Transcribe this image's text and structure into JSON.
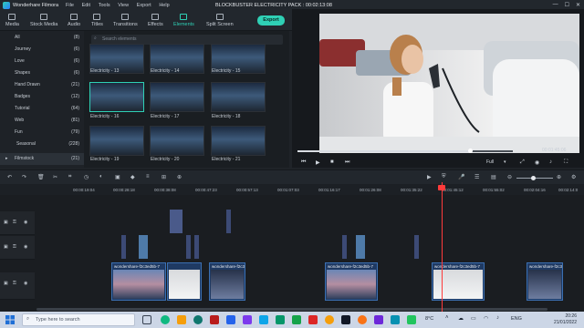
{
  "app": {
    "title": "Wonderhare Filmora",
    "project": "BLOCKBUSTER ELECTRICITY PACK : 00:02:13:08"
  },
  "menu": [
    "File",
    "Edit",
    "Tools",
    "View",
    "Export",
    "Help"
  ],
  "tabs": [
    {
      "label": "Media"
    },
    {
      "label": "Stock Media"
    },
    {
      "label": "Audio"
    },
    {
      "label": "Titles"
    },
    {
      "label": "Transitions"
    },
    {
      "label": "Effects"
    },
    {
      "label": "Elements",
      "active": true
    },
    {
      "label": "Split Screen"
    }
  ],
  "export_label": "Export",
  "sidebar": {
    "items": [
      {
        "label": "All",
        "count": "(8)"
      },
      {
        "label": "Journey",
        "count": "(6)"
      },
      {
        "label": "Love",
        "count": "(6)"
      },
      {
        "label": "Shapes",
        "count": "(6)"
      },
      {
        "label": "Hand Drawn",
        "count": "(21)"
      },
      {
        "label": "Badges",
        "count": "(12)"
      },
      {
        "label": "Tutorial",
        "count": "(64)"
      },
      {
        "label": "Web",
        "count": "(81)"
      },
      {
        "label": "Fun",
        "count": "(79)"
      },
      {
        "label": "Seasonal",
        "count": "(228)"
      },
      {
        "label": "Filmstock",
        "count": "(21)",
        "selected": true
      }
    ]
  },
  "search": {
    "placeholder": "Search elements"
  },
  "elements": [
    "Electricity - 13",
    "Electricity - 14",
    "Electricity - 15",
    "Electricity - 16",
    "Electricity - 17",
    "Electricity - 18",
    "Electricity - 19",
    "Electricity - 20",
    "Electricity - 21"
  ],
  "player": {
    "timecode": "00:01:45:06",
    "quality": "Full",
    "progress": 0.8
  },
  "ruler": {
    "ticks": [
      "00:00:19:04",
      "00:00:28:18",
      "00:00:38:08",
      "00:00:47:23",
      "00:00:57:13",
      "00:01:07:03",
      "00:01:16:17",
      "00:01:26:08",
      "00:01:35:22",
      "00:01:45:12",
      "00:01:55:02",
      "00:02:04:16",
      "00:02:14:0"
    ]
  },
  "clips": [
    "wondershare-f2c3ed5b-7",
    "wondershare-f2c3ed5b-7",
    "wondershare-f2c3ed5b-7",
    "wondershare-f2c3ed5b-7",
    "wondershare-f2c3ed5b-7",
    "wondershare-f2c3ed5b-7"
  ],
  "taskbar": {
    "search_placeholder": "Type here to search",
    "temp": "8°C",
    "lang": "ENG",
    "time": "20:26",
    "date": "21/01/2022"
  }
}
